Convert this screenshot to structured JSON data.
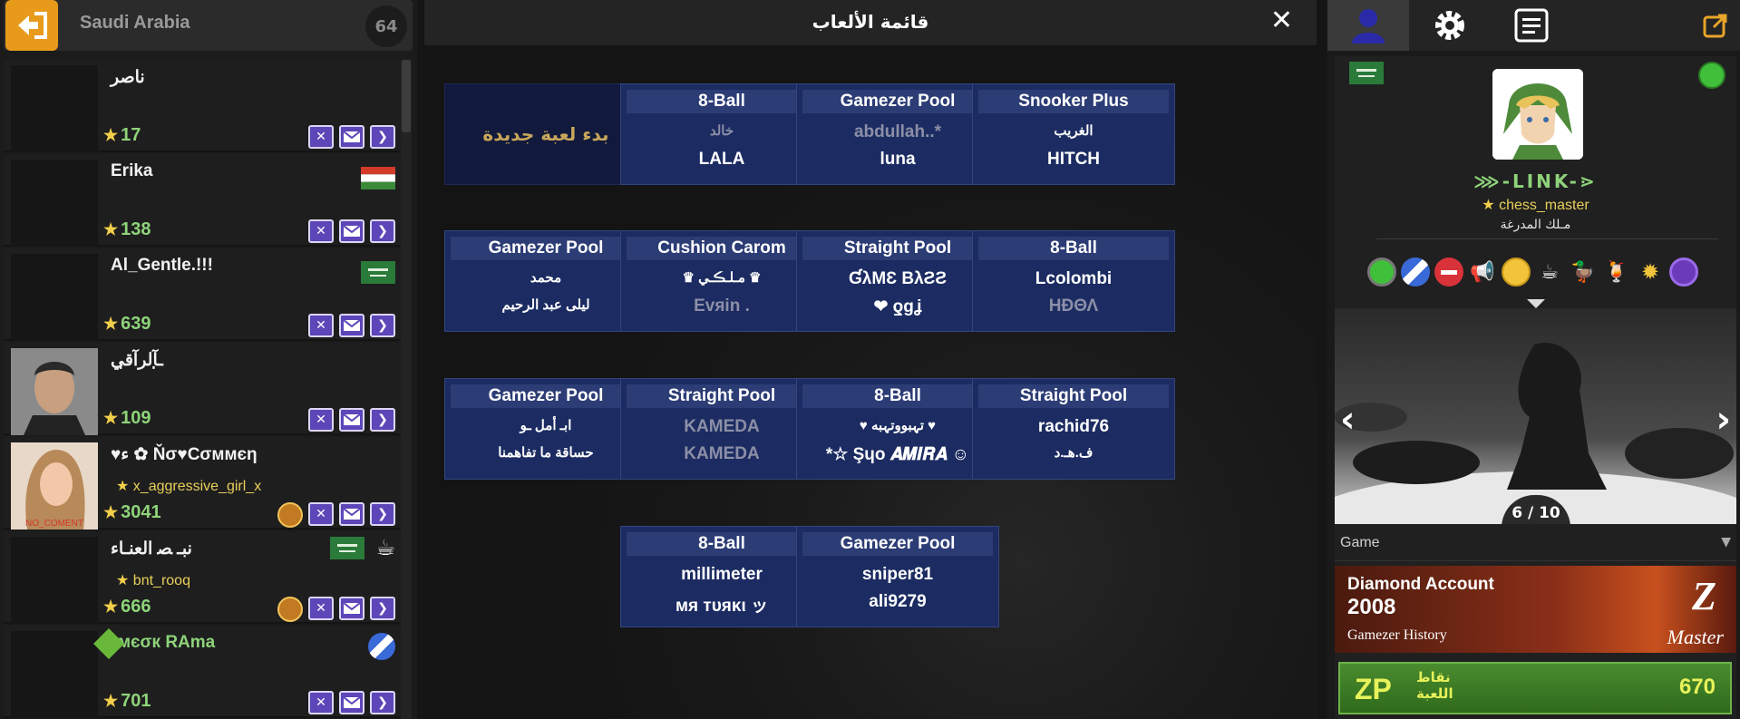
{
  "colors": {
    "accent_orange": "#e89a1b",
    "card_bg": "#1c2c62",
    "score_green": "#8ed37a",
    "star_gold": "#f2cf4a",
    "button_purple": "#5c46b8"
  },
  "left": {
    "country": "Saudi Arabia",
    "count": "64",
    "players": [
      {
        "name": "ناصر",
        "sub": "",
        "score": "17",
        "flag": "",
        "medal": false,
        "avatar": "empty"
      },
      {
        "name": "Erika",
        "sub": "",
        "score": "138",
        "flag": "hungary",
        "medal": false,
        "avatar": "empty"
      },
      {
        "name": "Al_Gentle.!!!",
        "sub": "",
        "score": "639",
        "flag": "saudi",
        "medal": false,
        "avatar": "empty"
      },
      {
        "name": "ـ̣آلرآق̣ي",
        "sub": "",
        "score": "109",
        "flag": "",
        "medal": false,
        "avatar": "man"
      },
      {
        "name": "♥ء ✿ Ňσ♥Cσммєη",
        "sub": "x_aggressive_girl_x",
        "score": "3041",
        "flag": "",
        "medal": true,
        "avatar": "woman"
      },
      {
        "name": "نبـ ﺼ العنـاء",
        "sub": "bnt_rooq",
        "score": "666",
        "flag": "saudi",
        "medal": true,
        "avatar": "empty"
      },
      {
        "name": "мєσк RAma",
        "sub": "",
        "score": "701",
        "flag": "",
        "medal": false,
        "avatar": "empty"
      }
    ]
  },
  "center": {
    "title": "قائمة الألعاب",
    "new_game": "بدء لعبة جديدة",
    "games": [
      {
        "title": "8-Ball",
        "p1": "خالد",
        "p2": "LALA",
        "p1_dim": true,
        "p2_dim": false
      },
      {
        "title": "Gamezer Pool",
        "p1": "abdullah..*",
        "p2": "luna",
        "p1_dim": true,
        "p2_dim": false
      },
      {
        "title": "Snooker Plus",
        "p1": "الغريب",
        "p2": "HITCH",
        "p1_dim": false,
        "p2_dim": false
      },
      {
        "title": "Gamezer Pool",
        "p1": "محمد",
        "p2": "ليلى عبد الرحيم",
        "p1_dim": false,
        "p2_dim": false
      },
      {
        "title": "Cushion Carom",
        "p1": "♛ مـلـڪـي ♛",
        "p2": "Evяin .",
        "p1_dim": false,
        "p2_dim": true
      },
      {
        "title": "Straight Pool",
        "p1": "ƓλMƐ BλƧƧ",
        "p2": "❤ ƍɡʝ",
        "p1_dim": false,
        "p2_dim": false
      },
      {
        "title": "8-Ball",
        "p1": "Lcolombi",
        "p2": "HÐΘΛ",
        "p1_dim": false,
        "p2_dim": true
      },
      {
        "title": "Gamezer Pool",
        "p1": "ابـ أمل ـو",
        "p2": "حساقة ما تفاهمنا",
        "p1_dim": false,
        "p2_dim": false
      },
      {
        "title": "Straight Pool",
        "p1": "KAMEDA",
        "p2": "KAMEDA",
        "p1_dim": true,
        "p2_dim": true
      },
      {
        "title": "8-Ball",
        "p1": "♥ تہبووتہبه ♥",
        "p2": "*☆ Şɥo 𝑨𝑴𝑰𝑹𝑨 ☺",
        "p1_dim": false,
        "p2_dim": false
      },
      {
        "title": "Straight Pool",
        "p1": "rachid76",
        "p2": "ف.هـ.د",
        "p1_dim": false,
        "p2_dim": false
      },
      {
        "title": "8-Ball",
        "p1": "millimeter",
        "p2": "мя тυяκι ッ",
        "p1_dim": false,
        "p2_dim": false
      },
      {
        "title": "Gamezer Pool",
        "p1": "sniper81",
        "p2": "ali9279",
        "p1_dim": false,
        "p2_dim": false
      }
    ]
  },
  "right": {
    "tabs": [
      "profile-icon",
      "gear-icon",
      "list-icon",
      "popout-icon"
    ],
    "profile": {
      "name": "⋙-LINK-⋗",
      "username": "chess_master",
      "title": "مـلك المدرغة",
      "status": "online"
    },
    "carousel": {
      "counter": "6 / 10"
    },
    "dropdown": {
      "value": "Game"
    },
    "diamond": {
      "title": "Diamond Account",
      "year": "2008",
      "history": "Gamezer History",
      "rank": "Master",
      "logo": "Z"
    },
    "zp": {
      "label": "ZP",
      "points_label": "نقاط اللعبة",
      "points": "670"
    }
  }
}
